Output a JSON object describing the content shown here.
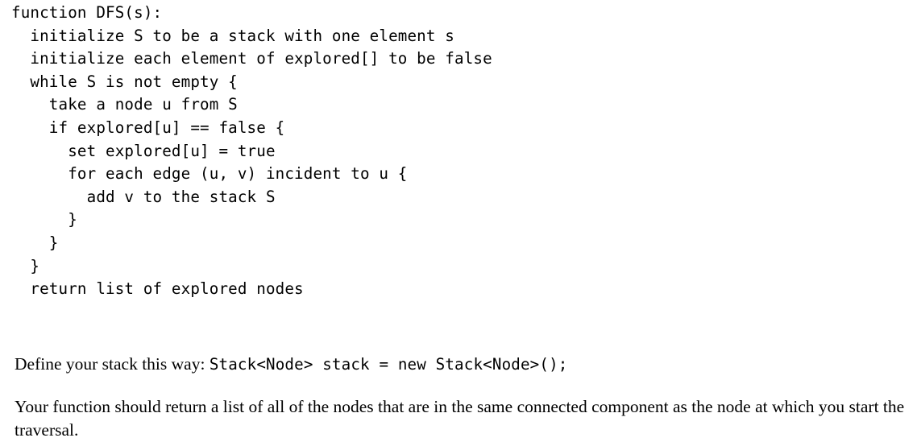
{
  "document": {
    "background_color": "#ffffff",
    "text_color": "#000000",
    "code": {
      "lines": [
        "function DFS(s):",
        "  initialize S to be a stack with one element s",
        "  initialize each element of explored[] to be false",
        "  while S is not empty {",
        "    take a node u from S",
        "    if explored[u] == false {",
        "      set explored[u] = true",
        "      for each edge (u, v) incident to u {",
        "        add v to the stack S",
        "      }",
        "    }",
        "  }",
        "  return list of explored nodes"
      ]
    },
    "paragraphs": {
      "define": {
        "lead_text": "Define your stack this way: ",
        "code_snippet": "Stack<Node> stack = new Stack<Node>();"
      },
      "return_description": {
        "text": "Your function should return a list of all of the nodes that are in the same connected component as the node at which you start the traversal."
      }
    }
  }
}
